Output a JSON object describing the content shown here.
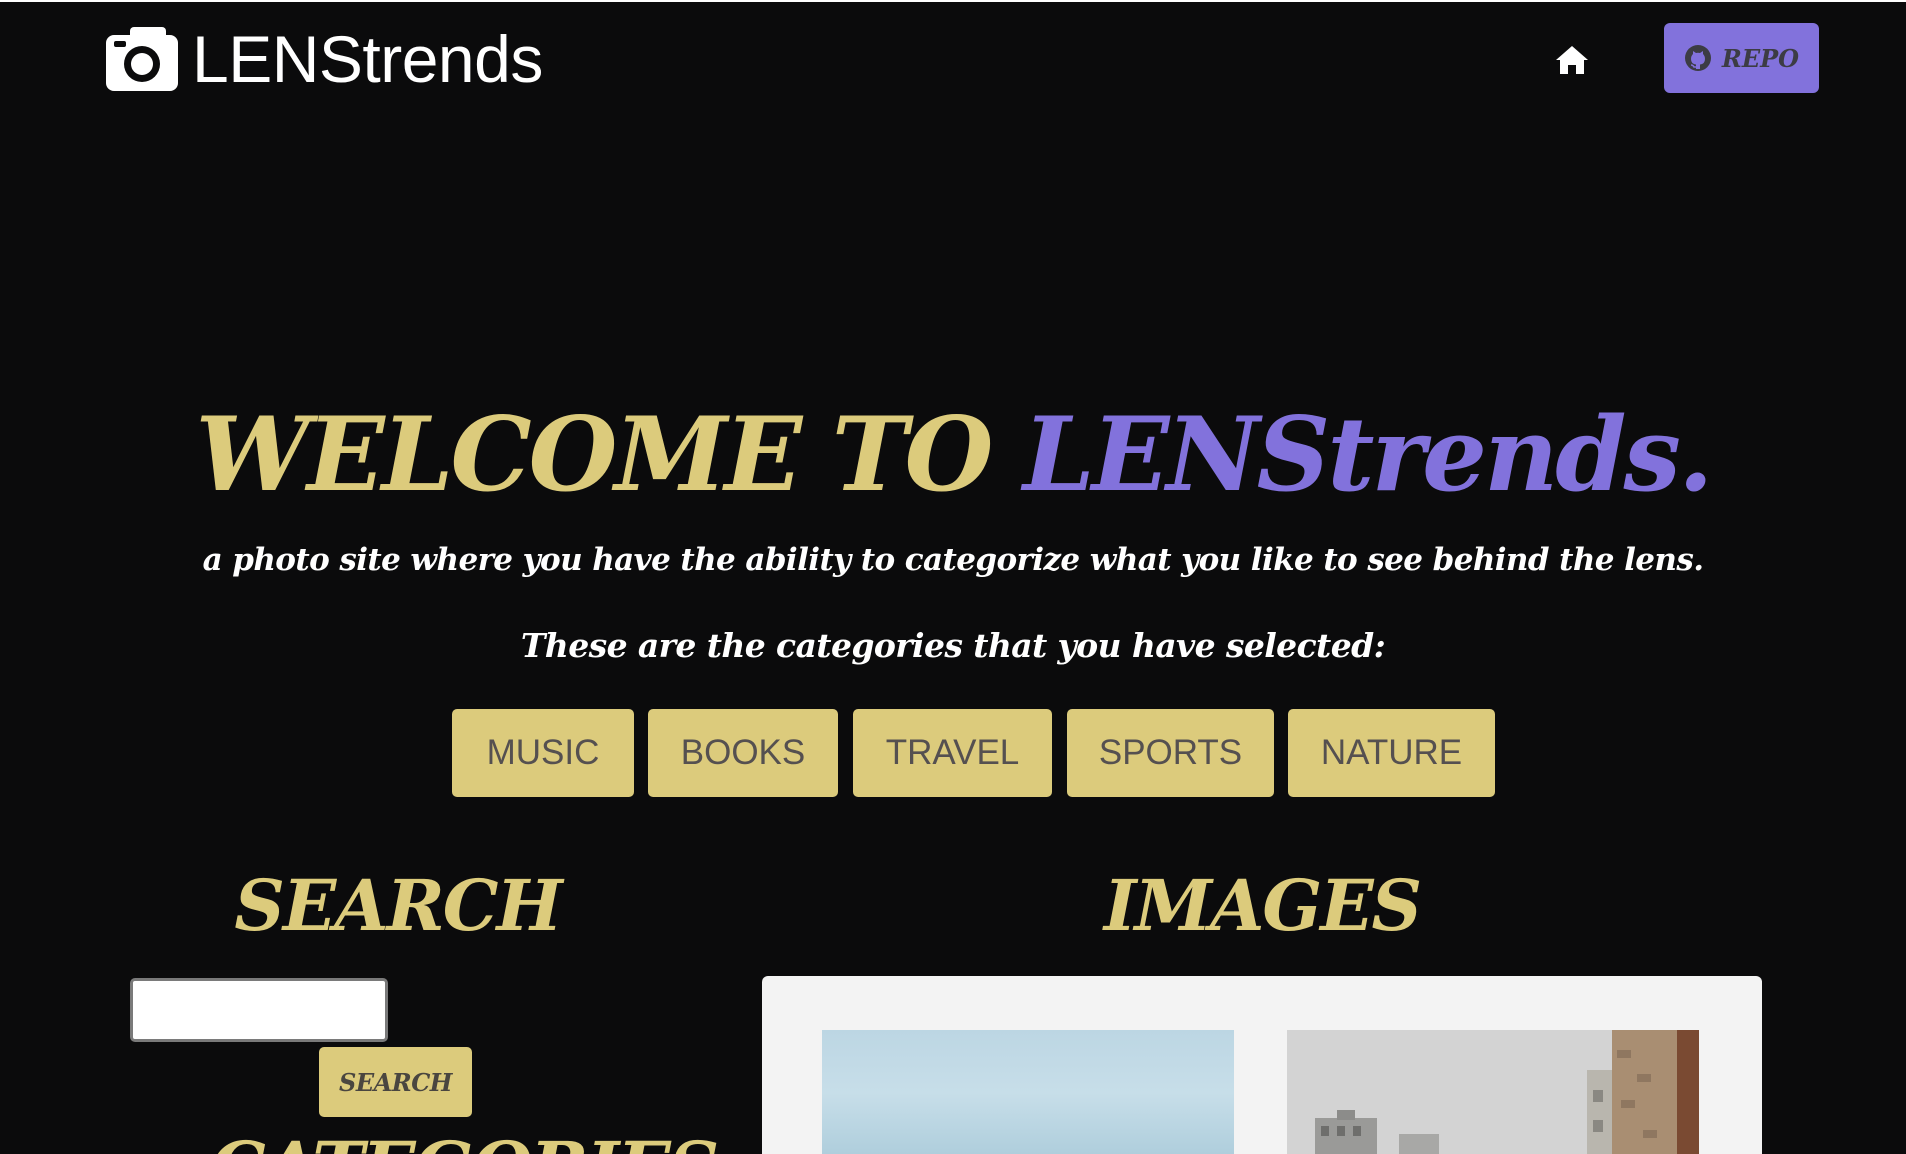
{
  "header": {
    "brand_name": "LENStrends",
    "brand_icon": "camera-icon",
    "home_icon": "home-icon",
    "repo_label": "REPO",
    "repo_icon": "github-icon"
  },
  "hero": {
    "title_prefix": "WELCOME TO",
    "title_highlight": "LENStrends.",
    "subtitle": "a photo site where you have the ability to categorize what you like to see behind the lens.",
    "categories_caption": "These are the categories that you have selected:"
  },
  "categories": [
    "MUSIC",
    "BOOKS",
    "TRAVEL",
    "SPORTS",
    "NATURE"
  ],
  "search": {
    "heading": "SEARCH",
    "input_value": "",
    "button_label": "SEARCH"
  },
  "images": {
    "heading": "IMAGES"
  },
  "categories_section": {
    "heading": "CATEGORIES"
  },
  "colors": {
    "background": "#0b0b0c",
    "gold": "#dccb7c",
    "purple": "#8272dc",
    "panel": "#f3f3f3"
  }
}
